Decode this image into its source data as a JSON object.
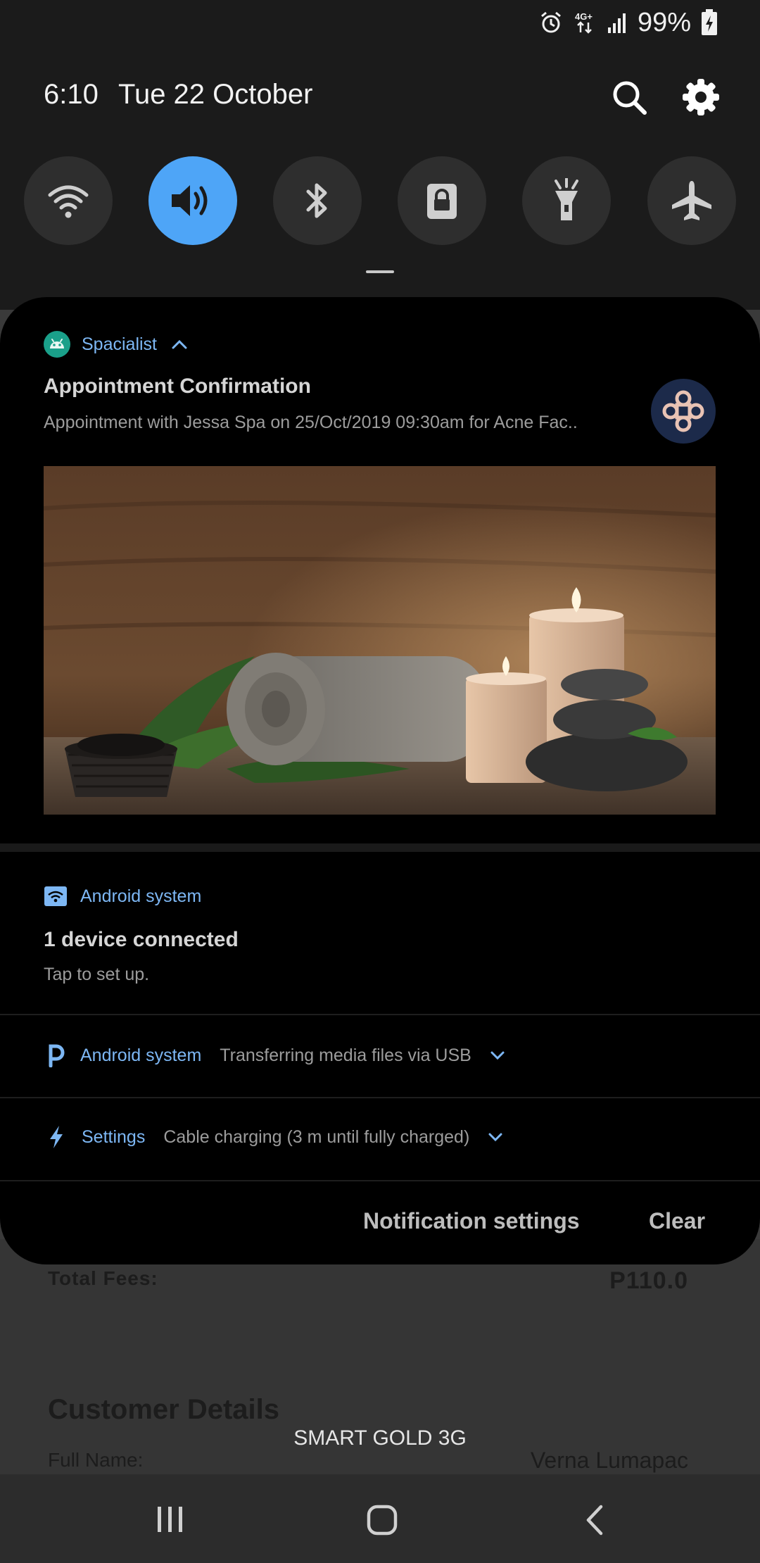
{
  "status_bar": {
    "battery_percent": "99%",
    "network": "4G+"
  },
  "quick_panel": {
    "time": "6:10",
    "date": "Tue 22 October",
    "toggles": [
      {
        "name": "wifi-icon",
        "active": false
      },
      {
        "name": "sound-icon",
        "active": true
      },
      {
        "name": "bluetooth-icon",
        "active": false
      },
      {
        "name": "rotation-lock-icon",
        "active": false
      },
      {
        "name": "flashlight-icon",
        "active": false
      },
      {
        "name": "airplane-mode-icon",
        "active": false
      }
    ],
    "accent_color": "#4ea5f7"
  },
  "notifications": {
    "spacialist": {
      "app_name": "Spacialist",
      "title": "Appointment Confirmation",
      "text": "Appointment with Jessa Spa on 25/Oct/2019 09:30am for Acne Fac.."
    },
    "device": {
      "app_name": "Android system",
      "title": "1 device connected",
      "text": "Tap to set up."
    },
    "usb": {
      "app_name": "Android system",
      "text": "Transferring media files via USB"
    },
    "charging": {
      "app_name": "Settings",
      "text": "Cable charging (3 m until fully charged)"
    }
  },
  "footer": {
    "notification_settings": "Notification settings",
    "clear": "Clear"
  },
  "background_app": {
    "total_fees_label": "Total Fees:",
    "total_fees_value": "P110.0",
    "customer_details_title": "Customer Details",
    "full_name_label": "Full Name:",
    "full_name_value": "Verna Lumapac"
  },
  "carrier": "SMART GOLD 3G"
}
